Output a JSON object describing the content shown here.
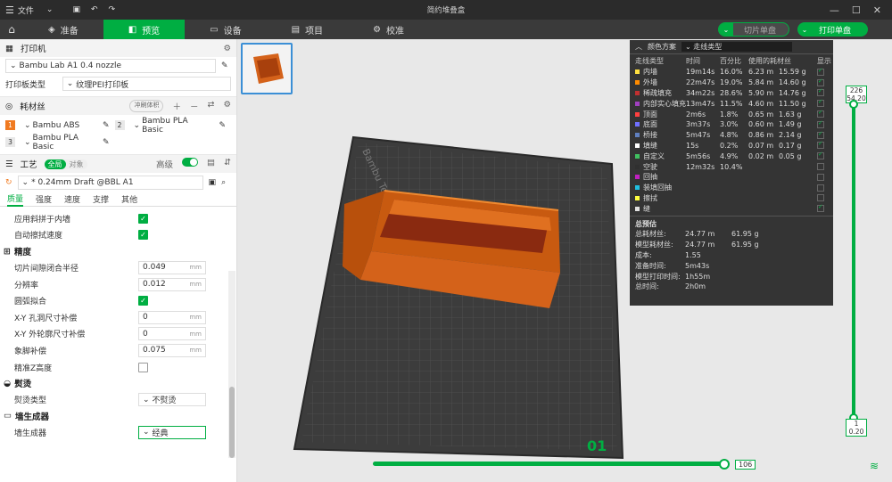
{
  "titlebar": {
    "file_menu": "文件",
    "title": "简约堆叠盒"
  },
  "tabs": [
    {
      "label": "准备"
    },
    {
      "label": "预览"
    },
    {
      "label": "设备"
    },
    {
      "label": "项目"
    },
    {
      "label": "校准"
    }
  ],
  "actions": {
    "slice": "切片单盘",
    "print": "打印单盘"
  },
  "printer": {
    "header": "打印机",
    "name": "Bambu Lab A1 0.4 nozzle",
    "plate_label": "打印板类型",
    "plate_value": "纹理PEI打印板"
  },
  "filament": {
    "header": "耗材丝",
    "flush_btn": "冲刷体积",
    "items": [
      {
        "num": "1",
        "name": "Bambu ABS",
        "color": "#f07a20"
      },
      {
        "num": "2",
        "name": "Bambu PLA Basic",
        "color": "#e8e8e8"
      },
      {
        "num": "3",
        "name": "Bambu PLA Basic",
        "color": "#e8e8e8"
      }
    ]
  },
  "process": {
    "header": "工艺",
    "global": "全局",
    "object": "对象",
    "advanced": "高级",
    "preset": "* 0.24mm Draft @BBL A1",
    "subtabs": [
      "质量",
      "强度",
      "速度",
      "支撑",
      "其他"
    ]
  },
  "params": {
    "apply_seam": "应用斜拼于内墙",
    "auto_wipe": "自动擦拭速度",
    "precision_group": "精度",
    "slice_gap": "切片间隙闭合半径",
    "slice_gap_val": "0.049",
    "resolution": "分辨率",
    "resolution_val": "0.012",
    "arc_fit": "圆弧拟合",
    "xy_hole": "X-Y 孔洞尺寸补偿",
    "xy_hole_val": "0",
    "xy_contour": "X-Y 外轮廓尺寸补偿",
    "xy_contour_val": "0",
    "elephant": "象脚补偿",
    "elephant_val": "0.075",
    "precise_z": "精准Z高度",
    "ironing_group": "熨烫",
    "ironing_type": "熨烫类型",
    "ironing_type_val": "不熨烫",
    "wall_group": "墙生成器",
    "wall_gen": "墙生成器",
    "wall_gen_val": "经典",
    "unit": "mm"
  },
  "legend": {
    "title": "颜色方案",
    "scheme": "走线类型",
    "headers": [
      "走线类型",
      "时间",
      "百分比",
      "使用的耗材丝",
      "显示"
    ],
    "rows": [
      {
        "name": "内墙",
        "color": "#ffe040",
        "time": "19m14s",
        "pct": "16.0%",
        "len": "6.23 m",
        "wt": "15.59 g",
        "show": true
      },
      {
        "name": "外墙",
        "color": "#ff8c00",
        "time": "22m47s",
        "pct": "19.0%",
        "len": "5.84 m",
        "wt": "14.60 g",
        "show": true
      },
      {
        "name": "稀疏填充",
        "color": "#c03030",
        "time": "34m22s",
        "pct": "28.6%",
        "len": "5.90 m",
        "wt": "14.76 g",
        "show": true
      },
      {
        "name": "内部实心填充",
        "color": "#a040c0",
        "time": "13m47s",
        "pct": "11.5%",
        "len": "4.60 m",
        "wt": "11.50 g",
        "show": true
      },
      {
        "name": "顶面",
        "color": "#ff4040",
        "time": "2m6s",
        "pct": "1.8%",
        "len": "0.65 m",
        "wt": "1.63 g",
        "show": true
      },
      {
        "name": "底面",
        "color": "#7070ff",
        "time": "3m37s",
        "pct": "3.0%",
        "len": "0.60 m",
        "wt": "1.49 g",
        "show": true
      },
      {
        "name": "桥接",
        "color": "#6080c0",
        "time": "5m47s",
        "pct": "4.8%",
        "len": "0.86 m",
        "wt": "2.14 g",
        "show": true
      },
      {
        "name": "填缝",
        "color": "#ffffff",
        "time": "15s",
        "pct": "0.2%",
        "len": "0.07 m",
        "wt": "0.17 g",
        "show": true
      },
      {
        "name": "自定义",
        "color": "#40c060",
        "time": "5m56s",
        "pct": "4.9%",
        "len": "0.02 m",
        "wt": "0.05 g",
        "show": true
      },
      {
        "name": "空驶",
        "color": "#303030",
        "time": "12m32s",
        "pct": "10.4%",
        "len": "",
        "wt": "",
        "show": false
      },
      {
        "name": "回抽",
        "color": "#c020c0",
        "time": "",
        "pct": "",
        "len": "",
        "wt": "",
        "show": false
      },
      {
        "name": "装填回抽",
        "color": "#20c0e0",
        "time": "",
        "pct": "",
        "len": "",
        "wt": "",
        "show": false
      },
      {
        "name": "擦拭",
        "color": "#ffff40",
        "time": "",
        "pct": "",
        "len": "",
        "wt": "",
        "show": false
      },
      {
        "name": "缝",
        "color": "#e0e0e0",
        "time": "",
        "pct": "",
        "len": "",
        "wt": "",
        "show": true
      }
    ],
    "summary_title": "总预估",
    "summary": [
      {
        "k": "总耗材丝:",
        "v1": "24.77 m",
        "v2": "61.95 g"
      },
      {
        "k": "模型耗材丝:",
        "v1": "24.77 m",
        "v2": "61.95 g"
      },
      {
        "k": "成本:",
        "v1": "1.55",
        "v2": ""
      },
      {
        "k": "准备时间:",
        "v1": "5m43s",
        "v2": ""
      },
      {
        "k": "模型打印时间:",
        "v1": "1h55m",
        "v2": ""
      },
      {
        "k": "总时间:",
        "v1": "2h0m",
        "v2": ""
      }
    ]
  },
  "layers": {
    "top_count": "226",
    "top_height": "54.20",
    "bottom_count": "1",
    "bottom_height": "0.20",
    "move_value": "106"
  },
  "plate": {
    "name": "Bambu Textured PEI Plate",
    "number": "01"
  }
}
